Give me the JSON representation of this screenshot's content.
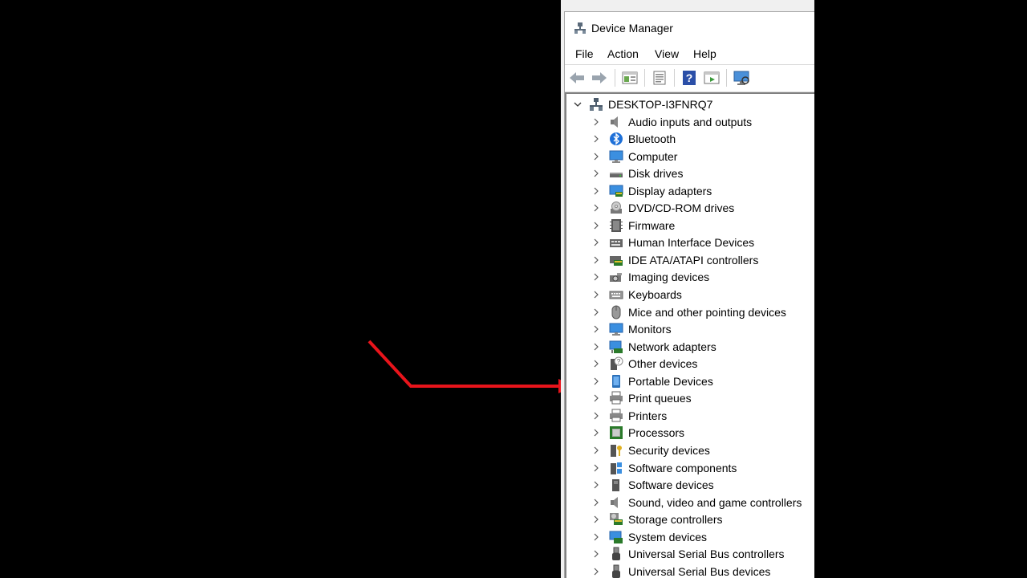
{
  "window": {
    "title": "Device Manager",
    "menu": [
      "File",
      "Action",
      "View",
      "Help"
    ],
    "toolbar": [
      "back-icon",
      "forward-icon",
      "properties-pane-icon",
      "properties-icon",
      "help-icon",
      "update-driver-icon",
      "scan-hardware-icon"
    ]
  },
  "tree": {
    "root": "DESKTOP-I3FNRQ7",
    "items": [
      {
        "label": "Audio inputs and outputs",
        "icon": "speaker-icon"
      },
      {
        "label": "Bluetooth",
        "icon": "bluetooth-icon"
      },
      {
        "label": "Computer",
        "icon": "computer-icon"
      },
      {
        "label": "Disk drives",
        "icon": "disk-drive-icon"
      },
      {
        "label": "Display adapters",
        "icon": "display-adapter-icon"
      },
      {
        "label": "DVD/CD-ROM drives",
        "icon": "dvd-icon"
      },
      {
        "label": "Firmware",
        "icon": "firmware-icon"
      },
      {
        "label": "Human Interface Devices",
        "icon": "hid-icon"
      },
      {
        "label": "IDE ATA/ATAPI controllers",
        "icon": "ide-controller-icon"
      },
      {
        "label": "Imaging devices",
        "icon": "camera-icon"
      },
      {
        "label": "Keyboards",
        "icon": "keyboard-icon"
      },
      {
        "label": "Mice and other pointing devices",
        "icon": "mouse-icon"
      },
      {
        "label": "Monitors",
        "icon": "monitor-icon"
      },
      {
        "label": "Network adapters",
        "icon": "network-adapter-icon"
      },
      {
        "label": "Other devices",
        "icon": "unknown-device-icon"
      },
      {
        "label": "Portable Devices",
        "icon": "portable-device-icon"
      },
      {
        "label": "Print queues",
        "icon": "print-queue-icon"
      },
      {
        "label": "Printers",
        "icon": "printer-icon"
      },
      {
        "label": "Processors",
        "icon": "processor-icon"
      },
      {
        "label": "Security devices",
        "icon": "security-device-icon"
      },
      {
        "label": "Software components",
        "icon": "software-component-icon"
      },
      {
        "label": "Software devices",
        "icon": "software-device-icon"
      },
      {
        "label": "Sound, video and game controllers",
        "icon": "sound-controller-icon"
      },
      {
        "label": "Storage controllers",
        "icon": "storage-controller-icon"
      },
      {
        "label": "System devices",
        "icon": "system-device-icon"
      },
      {
        "label": "Universal Serial Bus controllers",
        "icon": "usb-controller-icon"
      },
      {
        "label": "Universal Serial Bus devices",
        "icon": "usb-device-icon"
      }
    ]
  },
  "annotation": {
    "color": "#e8141b",
    "points_to": "Portable Devices"
  }
}
